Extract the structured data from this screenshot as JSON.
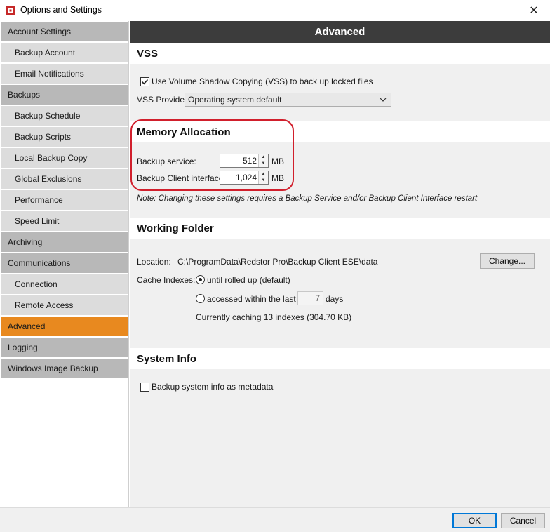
{
  "window": {
    "title": "Options and Settings",
    "close_label": "✕"
  },
  "sidebar": {
    "items": [
      {
        "label": "Account Settings",
        "level": "top"
      },
      {
        "label": "Backup Account",
        "level": "sub"
      },
      {
        "label": "Email Notifications",
        "level": "sub"
      },
      {
        "label": "Backups",
        "level": "top"
      },
      {
        "label": "Backup Schedule",
        "level": "sub"
      },
      {
        "label": "Backup Scripts",
        "level": "sub"
      },
      {
        "label": "Local Backup Copy",
        "level": "sub"
      },
      {
        "label": "Global Exclusions",
        "level": "sub"
      },
      {
        "label": "Performance",
        "level": "sub"
      },
      {
        "label": "Speed Limit",
        "level": "sub"
      },
      {
        "label": "Archiving",
        "level": "top"
      },
      {
        "label": "Communications",
        "level": "top"
      },
      {
        "label": "Connection",
        "level": "sub"
      },
      {
        "label": "Remote Access",
        "level": "sub"
      },
      {
        "label": "Advanced",
        "level": "top",
        "active": true
      },
      {
        "label": "Logging",
        "level": "top"
      },
      {
        "label": "Windows Image Backup",
        "level": "top"
      }
    ]
  },
  "main": {
    "title": "Advanced",
    "vss": {
      "heading": "VSS",
      "use_vss_label": "Use Volume Shadow Copying (VSS) to back up locked files",
      "use_vss_checked": true,
      "provider_label": "VSS Provider:",
      "provider_value": "Operating system default"
    },
    "memory": {
      "heading": "Memory Allocation",
      "service_label": "Backup service:",
      "service_value": "512",
      "service_unit": "MB",
      "client_label": "Backup Client interface:",
      "client_value": "1,024",
      "client_unit": "MB",
      "note": "Note: Changing these settings requires a Backup Service and/or Backup Client Interface restart"
    },
    "working_folder": {
      "heading": "Working Folder",
      "location_label": "Location:",
      "location_value": "C:\\ProgramData\\Redstor Pro\\Backup Client ESE\\data",
      "change_button": "Change...",
      "cache_label": "Cache Indexes:",
      "option_rolled": "until rolled up (default)",
      "option_accessed": "accessed within the last",
      "days_value": "7",
      "days_unit": "days",
      "selected_option": "rolled",
      "caching_status": "Currently caching 13 indexes (304.70 KB)"
    },
    "system_info": {
      "heading": "System Info",
      "metadata_label": "Backup system info as metadata",
      "metadata_checked": false
    }
  },
  "footer": {
    "ok_label": "OK",
    "cancel_label": "Cancel"
  },
  "colors": {
    "accent_active": "#e8891f",
    "header_bg": "#3c3c3c",
    "highlight_ring": "#d11f2c"
  }
}
